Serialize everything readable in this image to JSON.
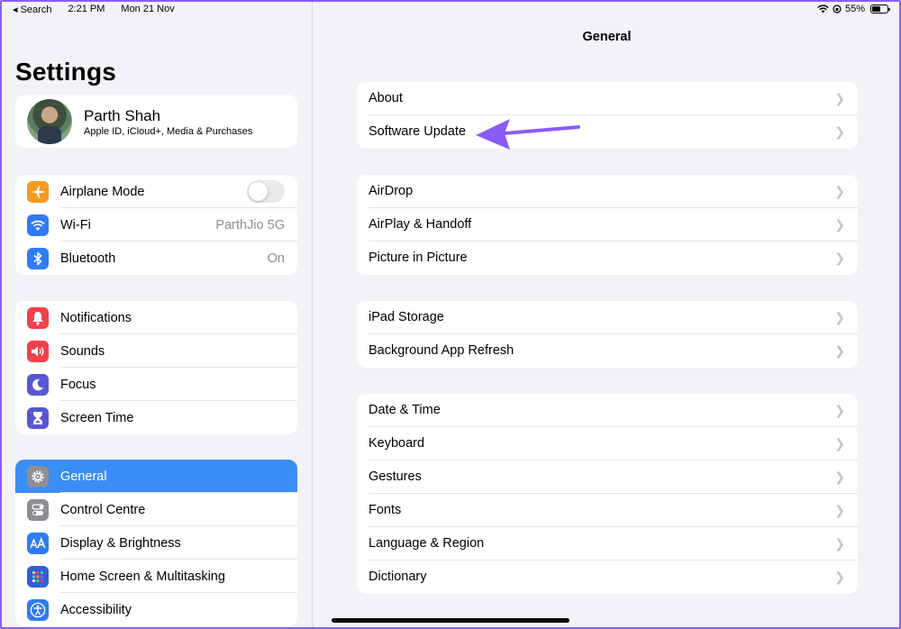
{
  "status_bar": {
    "back_label": "◂ Search",
    "time": "2:21 PM",
    "date": "Mon 21 Nov",
    "battery": "55%",
    "battery_level": 0.55
  },
  "sidebar": {
    "title": "Settings",
    "profile": {
      "name": "Parth Shah",
      "subtitle": "Apple ID, iCloud+, Media & Purchases"
    },
    "group1": [
      {
        "label": "Airplane Mode",
        "icon": "airplane-icon",
        "color": "#f59a23",
        "toggle": false
      },
      {
        "label": "Wi-Fi",
        "icon": "wifi-icon",
        "color": "#2f7cf6",
        "value": "ParthJio 5G"
      },
      {
        "label": "Bluetooth",
        "icon": "bluetooth-icon",
        "color": "#2f7cf6",
        "value": "On"
      }
    ],
    "group2": [
      {
        "label": "Notifications",
        "icon": "bell-icon",
        "color": "#f2414b"
      },
      {
        "label": "Sounds",
        "icon": "speaker-icon",
        "color": "#f2414b"
      },
      {
        "label": "Focus",
        "icon": "moon-icon",
        "color": "#5856d6"
      },
      {
        "label": "Screen Time",
        "icon": "hourglass-icon",
        "color": "#5856d6"
      }
    ],
    "group3": [
      {
        "label": "General",
        "icon": "gear-icon",
        "color": "#8e8e93",
        "selected": true
      },
      {
        "label": "Control Centre",
        "icon": "switches-icon",
        "color": "#8e8e93"
      },
      {
        "label": "Display & Brightness",
        "icon": "text-size-icon",
        "color": "#2f7cf6"
      },
      {
        "label": "Home Screen & Multitasking",
        "icon": "grid-icon",
        "color": "#2f5fd6"
      },
      {
        "label": "Accessibility",
        "icon": "accessibility-icon",
        "color": "#2f7cf6"
      }
    ]
  },
  "detail": {
    "title": "General",
    "groups": [
      [
        "About",
        "Software Update"
      ],
      [
        "AirDrop",
        "AirPlay & Handoff",
        "Picture in Picture"
      ],
      [
        "iPad Storage",
        "Background App Refresh"
      ],
      [
        "Date & Time",
        "Keyboard",
        "Gestures",
        "Fonts",
        "Language & Region",
        "Dictionary"
      ]
    ]
  },
  "colors": {
    "accent": "#3b8ef5",
    "annotation_arrow": "#8a5cf6"
  }
}
